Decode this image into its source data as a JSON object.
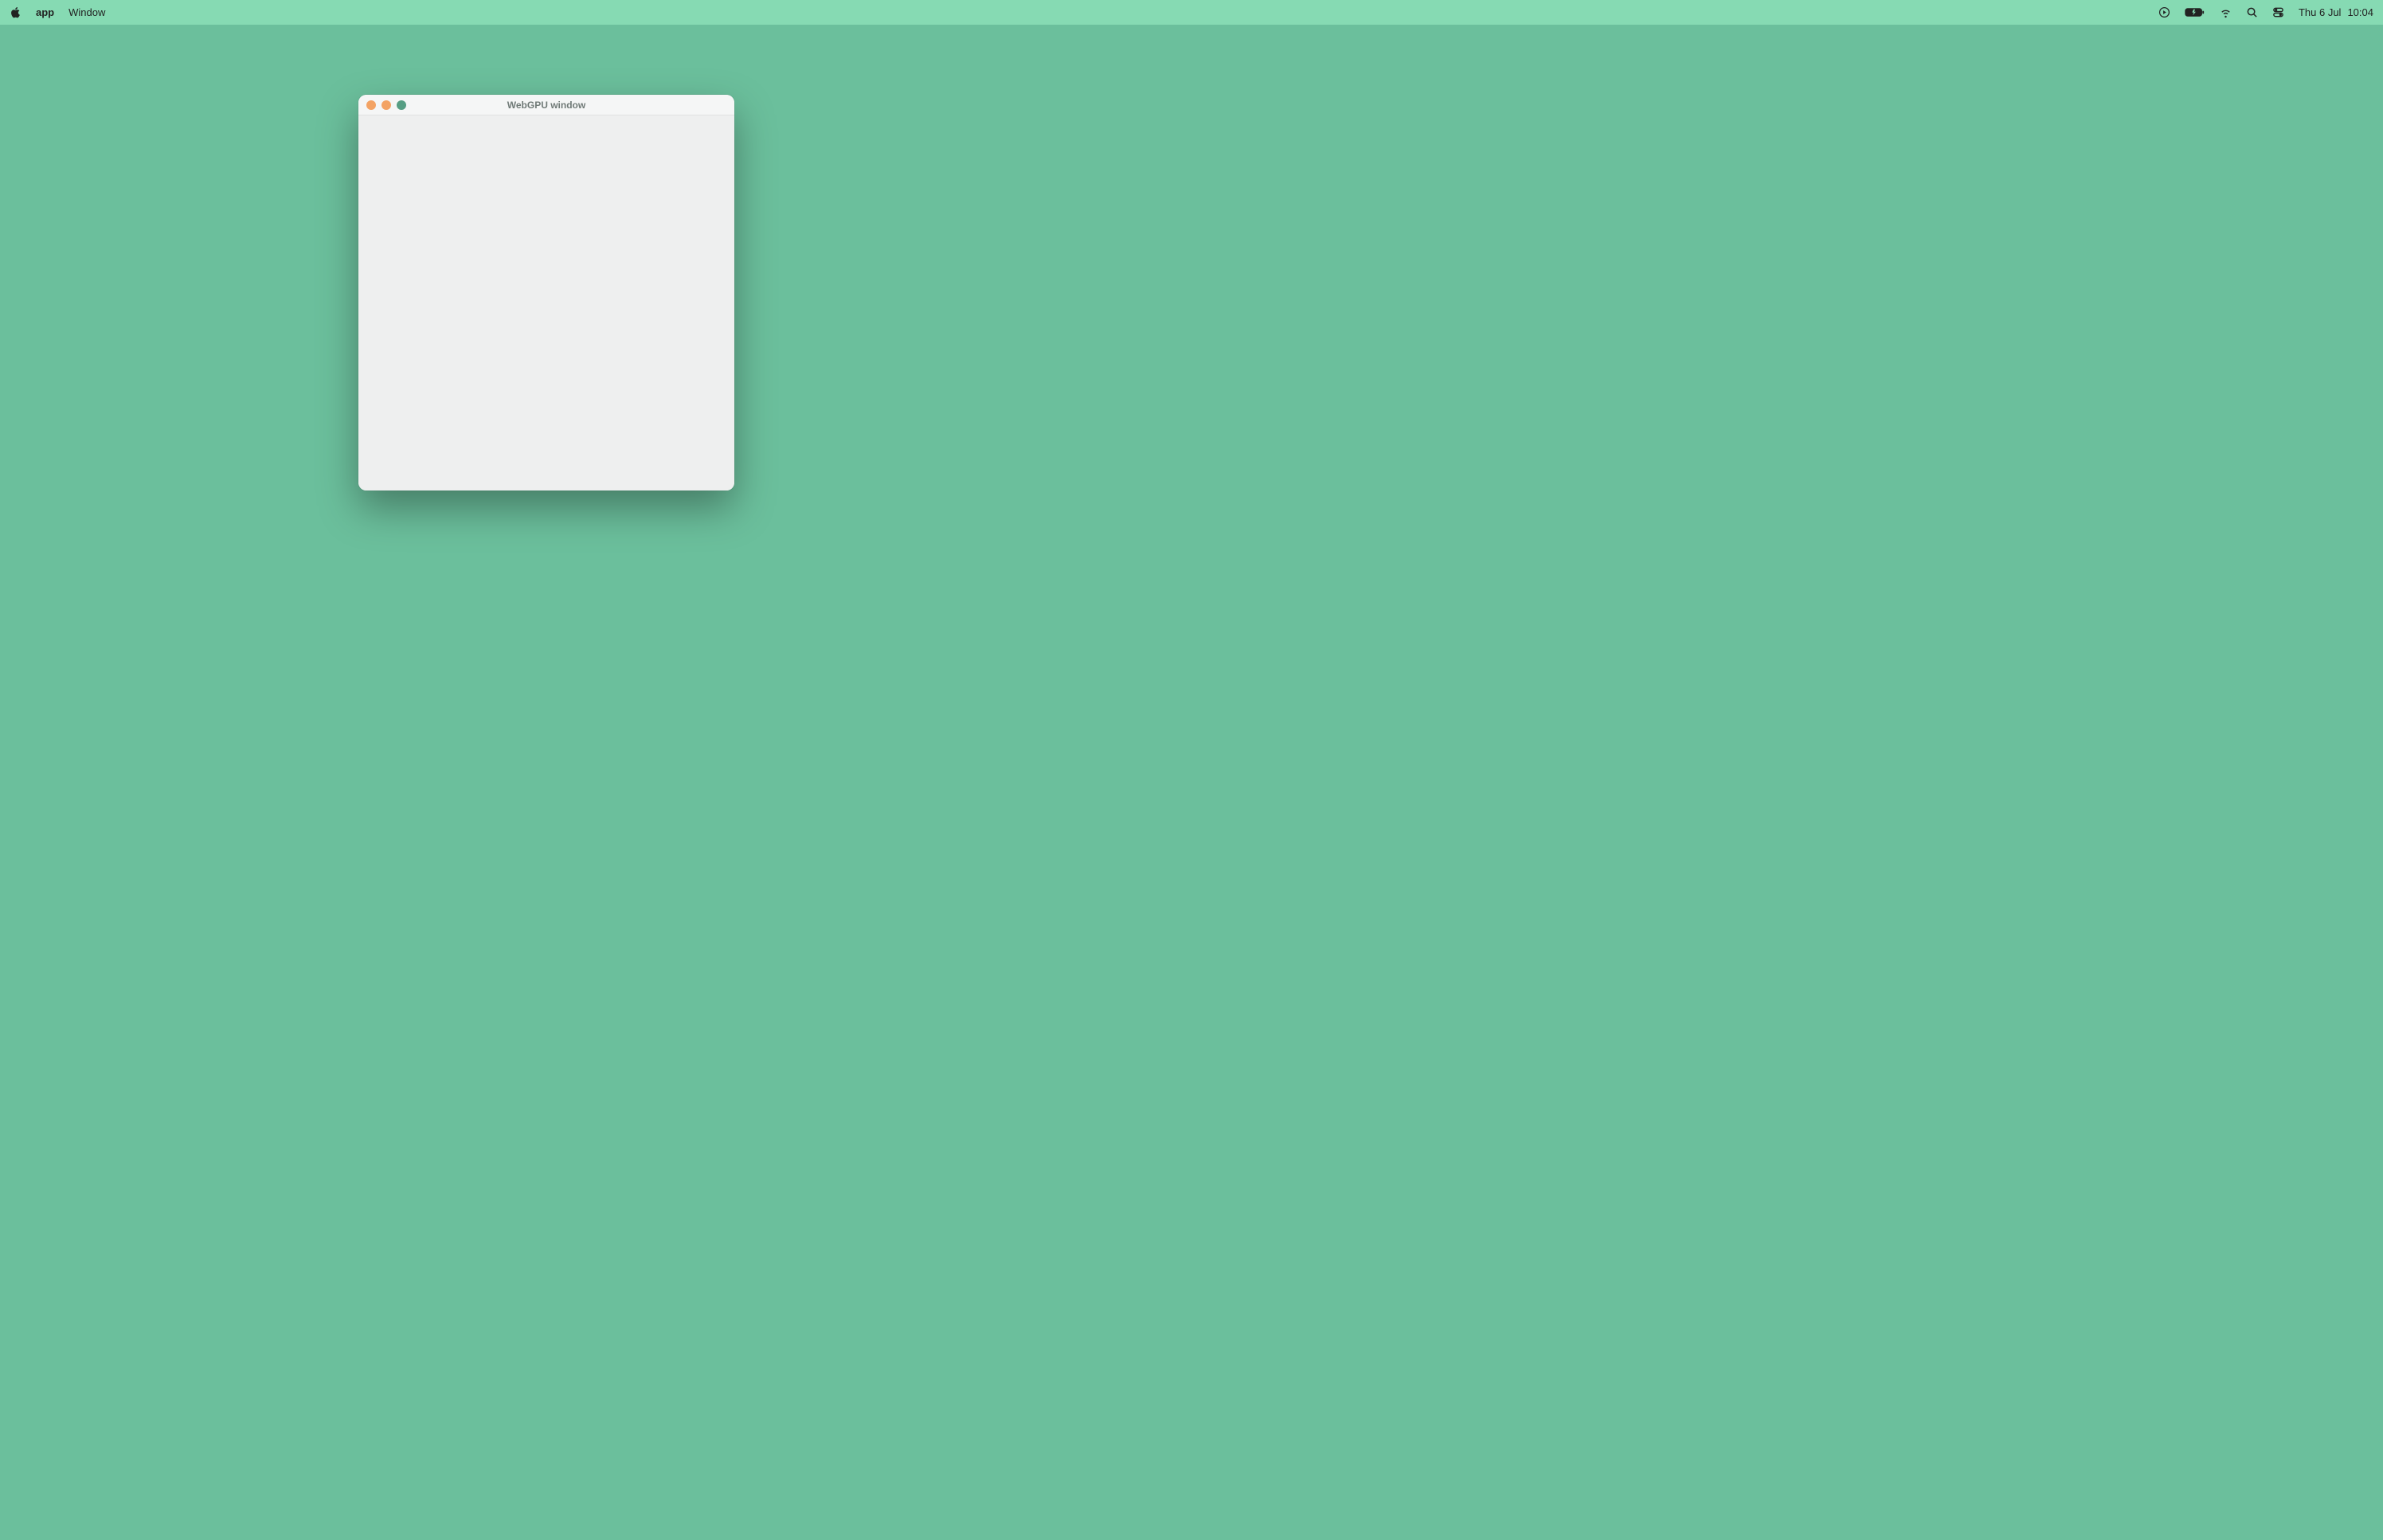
{
  "menubar": {
    "app_name": "app",
    "menus": [
      {
        "label": "Window"
      }
    ],
    "date": "Thu 6 Jul",
    "time": "10:04"
  },
  "window": {
    "title": "WebGPU window"
  },
  "colors": {
    "desktop": "#6bbf9c",
    "menubar": "#86dab3",
    "window_bg": "#eeefef",
    "titlebar_text": "#707a77"
  }
}
